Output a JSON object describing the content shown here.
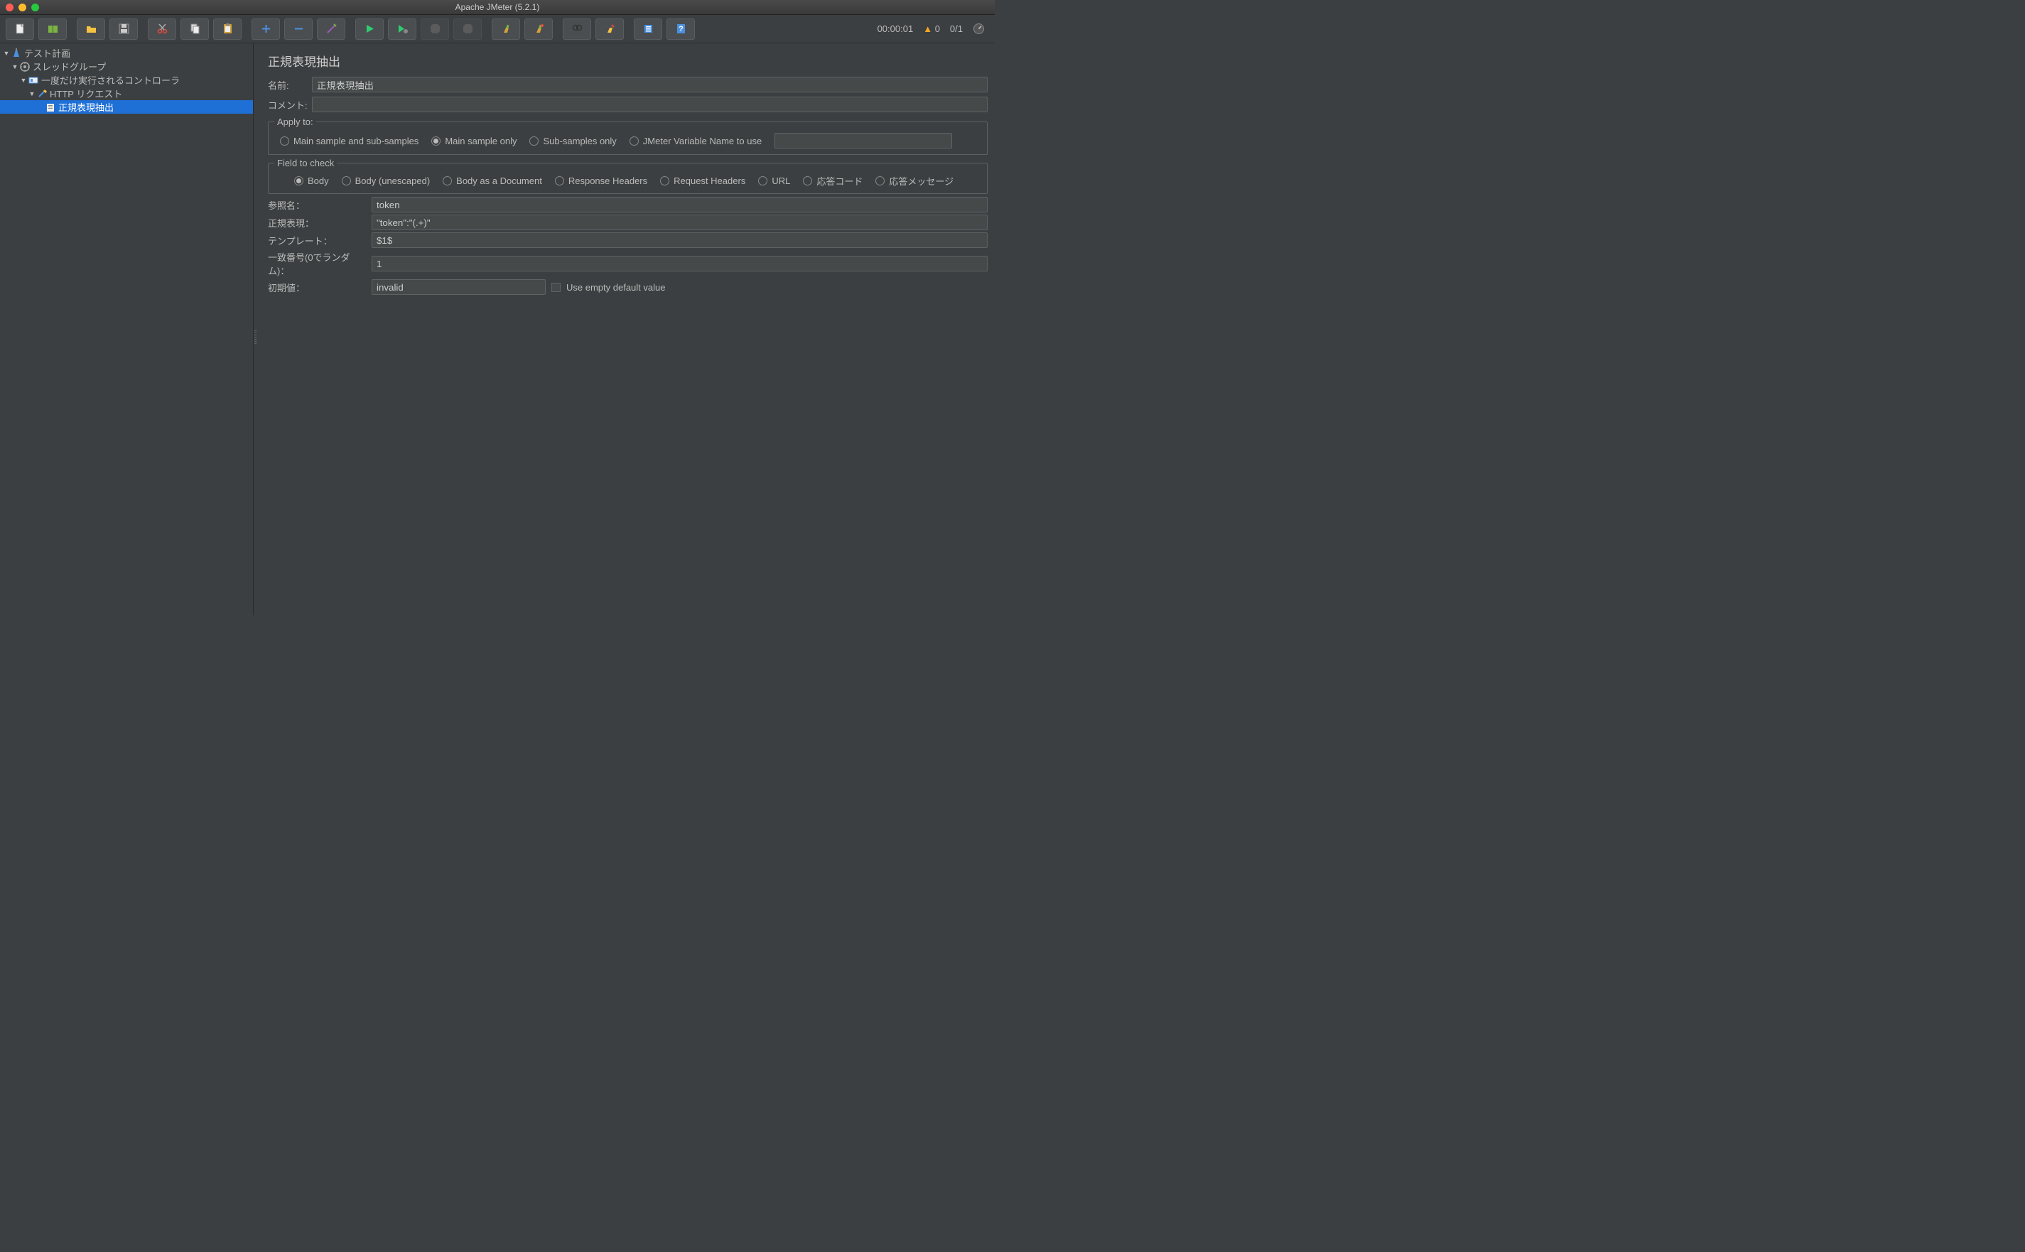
{
  "window_title": "Apache JMeter (5.2.1)",
  "status": {
    "elapsed": "00:00:01",
    "warnings": "0",
    "threads": "0/1"
  },
  "tree": {
    "plan": "テスト計画",
    "thread_group": "スレッドグループ",
    "once_controller": "一度だけ実行されるコントローラ",
    "http_request": "HTTP リクエスト",
    "regex_extractor": "正規表現抽出"
  },
  "panel": {
    "title": "正規表現抽出",
    "name_label": "名前:",
    "name_value": "正規表現抽出",
    "comment_label": "コメント:",
    "comment_value": "",
    "apply_to": {
      "legend": "Apply to:",
      "main_and_sub": "Main sample and sub-samples",
      "main_only": "Main sample only",
      "sub_only": "Sub-samples only",
      "jmeter_var": "JMeter Variable Name to use",
      "jmeter_var_value": ""
    },
    "field_to_check": {
      "legend": "Field to check",
      "body": "Body",
      "body_unescaped": "Body (unescaped)",
      "body_doc": "Body as a Document",
      "response_headers": "Response Headers",
      "request_headers": "Request Headers",
      "url": "URL",
      "resp_code": "応答コード",
      "resp_msg": "応答メッセージ"
    },
    "ref_name_label": "参照名：",
    "ref_name_value": "token",
    "regex_label": "正規表現：",
    "regex_value": "\"token\":\"(.+)\"",
    "template_label": "テンプレート：",
    "template_value": "$1$",
    "match_no_label": "一致番号(0でランダム)：",
    "match_no_value": "1",
    "default_label": "初期値：",
    "default_value": "invalid",
    "use_empty_label": "Use empty default value"
  }
}
